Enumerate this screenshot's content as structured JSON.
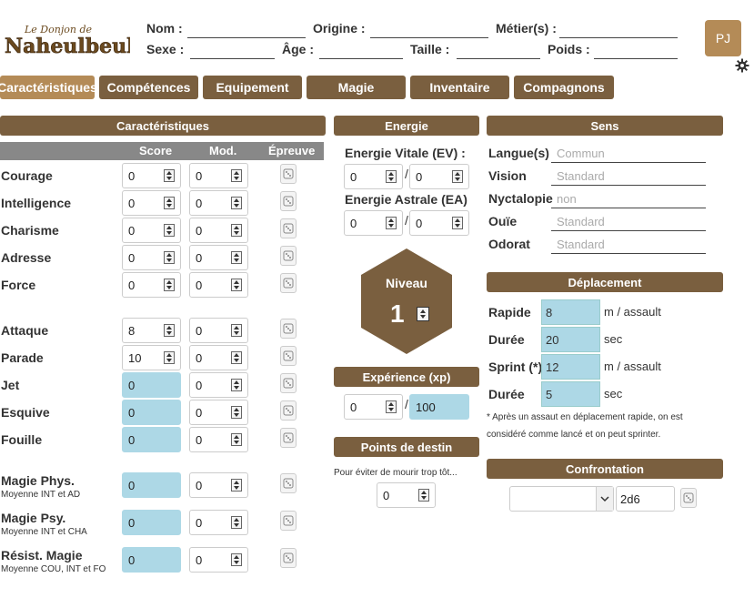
{
  "header": {
    "logo_text_1": "Le Donjon de",
    "logo_text_2": "Naheulbeuk",
    "nom_label": "Nom :",
    "origine_label": "Origine :",
    "metier_label": "Métier(s) :",
    "sexe_label": "Sexe :",
    "age_label": "Âge :",
    "taille_label": "Taille :",
    "poids_label": "Poids :",
    "nom_value": "",
    "origine_value": "",
    "metier_value": "",
    "sexe_value": "",
    "age_value": "",
    "taille_value": "",
    "poids_value": "",
    "pj_label": "PJ"
  },
  "tabs": [
    {
      "label": "Caractéristiques",
      "active": true
    },
    {
      "label": "Compétences"
    },
    {
      "label": "Equipement"
    },
    {
      "label": "Magie"
    },
    {
      "label": "Inventaire"
    },
    {
      "label": "Compagnons"
    }
  ],
  "carac": {
    "title": "Caractéristiques",
    "col_score": "Score",
    "col_mod": "Mod.",
    "col_epreuve": "Épreuve",
    "rows": [
      {
        "label": "Courage",
        "score": "0",
        "mod": "0"
      },
      {
        "label": "Intelligence",
        "score": "0",
        "mod": "0"
      },
      {
        "label": "Charisme",
        "score": "0",
        "mod": "0"
      },
      {
        "label": "Adresse",
        "score": "0",
        "mod": "0"
      },
      {
        "label": "Force",
        "score": "0",
        "mod": "0"
      },
      {
        "label": "Attaque",
        "score": "8",
        "mod": "0"
      },
      {
        "label": "Parade",
        "score": "10",
        "mod": "0"
      },
      {
        "label": "Jet",
        "score": "0",
        "mod": "0"
      },
      {
        "label": "Esquive",
        "score": "0",
        "mod": "0"
      },
      {
        "label": "Fouille",
        "score": "0",
        "mod": "0"
      },
      {
        "label": "Magie Phys.",
        "sub": "Moyenne INT et AD",
        "score": "0",
        "mod": "0"
      },
      {
        "label": "Magie Psy.",
        "sub": "Moyenne INT et CHA",
        "score": "0",
        "mod": "0"
      },
      {
        "label": "Résist. Magie",
        "sub": "Moyenne COU, INT et FO",
        "score": "0",
        "mod": "0"
      }
    ]
  },
  "energie": {
    "title": "Energie",
    "ev_label": "Energie Vitale (EV) :",
    "ev_value": "0",
    "ev_max": "0",
    "ea_label": "Energie Astrale (EA)",
    "ea_value": "0",
    "ea_max": "0",
    "slash": "/"
  },
  "niveau": {
    "label": "Niveau",
    "value": "1"
  },
  "experience": {
    "title": "Expérience (xp)",
    "value": "0",
    "max": "100"
  },
  "destin": {
    "title": "Points de destin",
    "desc": "Pour éviter de mourir trop tôt...",
    "value": "0"
  },
  "sens": {
    "title": "Sens",
    "rows": [
      {
        "label": "Langue(s)",
        "placeholder": "Commun"
      },
      {
        "label": "Vision",
        "placeholder": "Standard"
      },
      {
        "label": "Nyctalopie",
        "placeholder": "non"
      },
      {
        "label": "Ouïe",
        "placeholder": "Standard"
      },
      {
        "label": "Odorat",
        "placeholder": "Standard"
      }
    ]
  },
  "deplacement": {
    "title": "Déplacement",
    "rows": [
      {
        "label": "Rapide",
        "value": "8",
        "unit": "m / assault"
      },
      {
        "label": "Durée",
        "value": "20",
        "unit": "sec"
      },
      {
        "label": "Sprint (*)",
        "value": "12",
        "unit": "m / assault"
      },
      {
        "label": "Durée",
        "value": "5",
        "unit": "sec"
      }
    ],
    "note_1": "* Après un assaut en déplacement rapide, on est",
    "note_2": "considéré comme lancé et on peut sprinter."
  },
  "confrontation": {
    "title": "Confrontation",
    "select_value": "",
    "dice": "2d6"
  },
  "colors": {
    "brown": "#7a5f3f",
    "light_brown": "#b48b57",
    "blue_field": "#add8e6",
    "grey_header": "#888888"
  },
  "icons": {
    "settings": "gear-icon",
    "dice": "dice-icon"
  }
}
